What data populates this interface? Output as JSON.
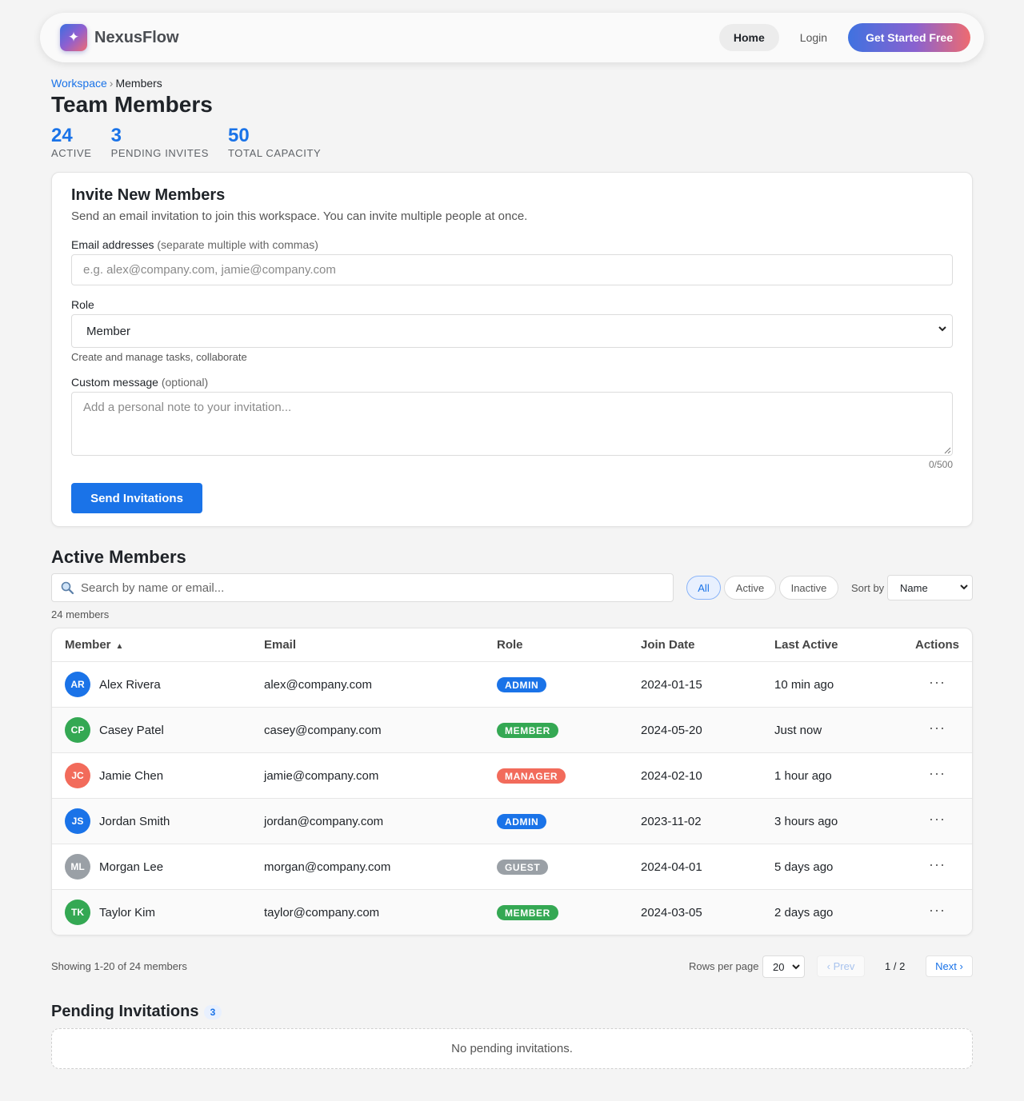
{
  "nav": {
    "logo_glyph": "✦",
    "brand": "NexusFlow",
    "home": "Home",
    "login": "Login",
    "cta": "Get Started Free"
  },
  "breadcrumb": {
    "parent": "Workspace",
    "separator": "›",
    "current": "Members"
  },
  "page_title": "Team Members",
  "stats": [
    {
      "value": "24",
      "label": "ACTIVE"
    },
    {
      "value": "3",
      "label": "PENDING INVITES"
    },
    {
      "value": "50",
      "label": "TOTAL CAPACITY"
    }
  ],
  "invite": {
    "title": "Invite New Members",
    "description": "Send an email invitation to join this workspace. You can invite multiple people at once.",
    "email_label": "Email addresses",
    "email_hint": "(separate multiple with commas)",
    "email_placeholder": "e.g. alex@company.com, jamie@company.com",
    "role_label": "Role",
    "role_value": "Member",
    "role_help": "Create and manage tasks, collaborate",
    "message_label": "Custom message",
    "message_hint": "(optional)",
    "message_placeholder": "Add a personal note to your invitation...",
    "char_count": "0/500",
    "submit": "Send Invitations"
  },
  "members": {
    "title": "Active Members",
    "search_placeholder": "Search by name or email...",
    "filters": [
      "All",
      "Active",
      "Inactive"
    ],
    "active_filter": "All",
    "sort_label": "Sort by",
    "sort_value": "Name",
    "count_text": "24 members",
    "columns": [
      "Member",
      "Email",
      "Role",
      "Join Date",
      "Last Active",
      "Actions"
    ],
    "sort_indicator": "▲",
    "rows": [
      {
        "initials": "AR",
        "name": "Alex Rivera",
        "email": "alex@company.com",
        "role": "ADMIN",
        "join_date": "2024-01-15",
        "last_active": "10 min ago",
        "avatar_color": "#1a73e8",
        "role_color": "#1a73e8"
      },
      {
        "initials": "CP",
        "name": "Casey Patel",
        "email": "casey@company.com",
        "role": "MEMBER",
        "join_date": "2024-05-20",
        "last_active": "Just now",
        "avatar_color": "#34a853",
        "role_color": "#34a853"
      },
      {
        "initials": "JC",
        "name": "Jamie Chen",
        "email": "jamie@company.com",
        "role": "MANAGER",
        "join_date": "2024-02-10",
        "last_active": "1 hour ago",
        "avatar_color": "#f26b5b",
        "role_color": "#f26b5b"
      },
      {
        "initials": "JS",
        "name": "Jordan Smith",
        "email": "jordan@company.com",
        "role": "ADMIN",
        "join_date": "2023-11-02",
        "last_active": "3 hours ago",
        "avatar_color": "#1a73e8",
        "role_color": "#1a73e8"
      },
      {
        "initials": "ML",
        "name": "Morgan Lee",
        "email": "morgan@company.com",
        "role": "GUEST",
        "join_date": "2024-04-01",
        "last_active": "5 days ago",
        "avatar_color": "#9aa0a6",
        "role_color": "#9aa0a6"
      },
      {
        "initials": "TK",
        "name": "Taylor Kim",
        "email": "taylor@company.com",
        "role": "MEMBER",
        "join_date": "2024-03-05",
        "last_active": "2 days ago",
        "avatar_color": "#34a853",
        "role_color": "#34a853"
      }
    ],
    "row_action_glyph": "···"
  },
  "pagination": {
    "showing": "Showing 1-20 of 24 members",
    "rows_per_page_label": "Rows per page",
    "rows_per_page": "20",
    "prev": "‹ Prev",
    "page": "1 / 2",
    "next": "Next ›"
  },
  "pending": {
    "title": "Pending Invitations",
    "count": "3",
    "empty": "No pending invitations."
  }
}
